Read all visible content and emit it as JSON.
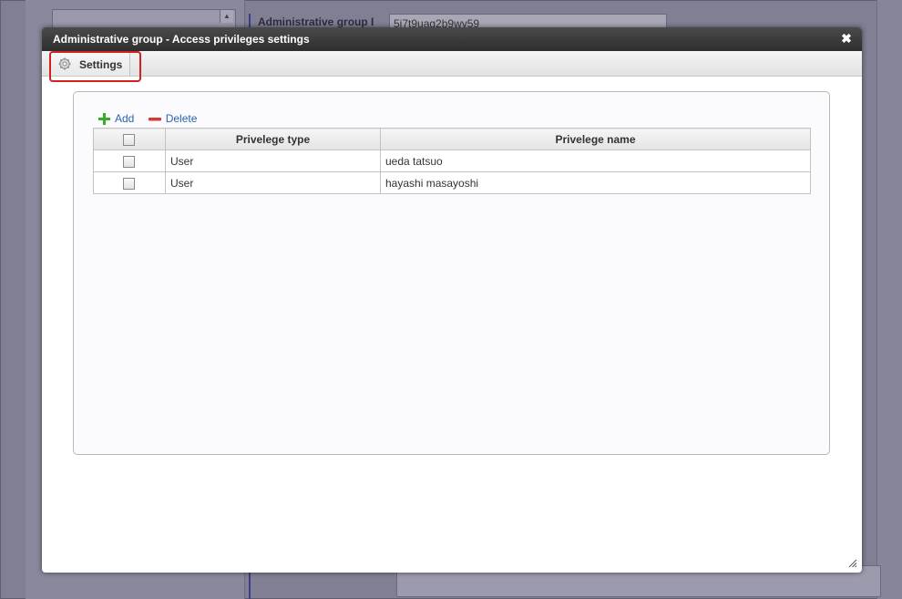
{
  "background": {
    "label": "Administrative group I",
    "input_value": "5i7t9uag2b9wy59"
  },
  "dialog": {
    "title": "Administrative group - Access privileges settings",
    "close_icon": "close-icon",
    "tabs": [
      {
        "label": "Settings",
        "icon": "gear-icon"
      }
    ],
    "toolbar": {
      "add_label": "Add",
      "delete_label": "Delete"
    },
    "table": {
      "headers": {
        "type": "Privelege type",
        "name": "Privelege name"
      },
      "rows": [
        {
          "type": "User",
          "name": "ueda tatsuo"
        },
        {
          "type": "User",
          "name": "hayashi masayoshi"
        }
      ]
    }
  },
  "colors": {
    "highlight": "#d42020",
    "link": "#2a64b0",
    "add_icon": "#3bab2f",
    "delete_icon": "#d33a3a"
  }
}
